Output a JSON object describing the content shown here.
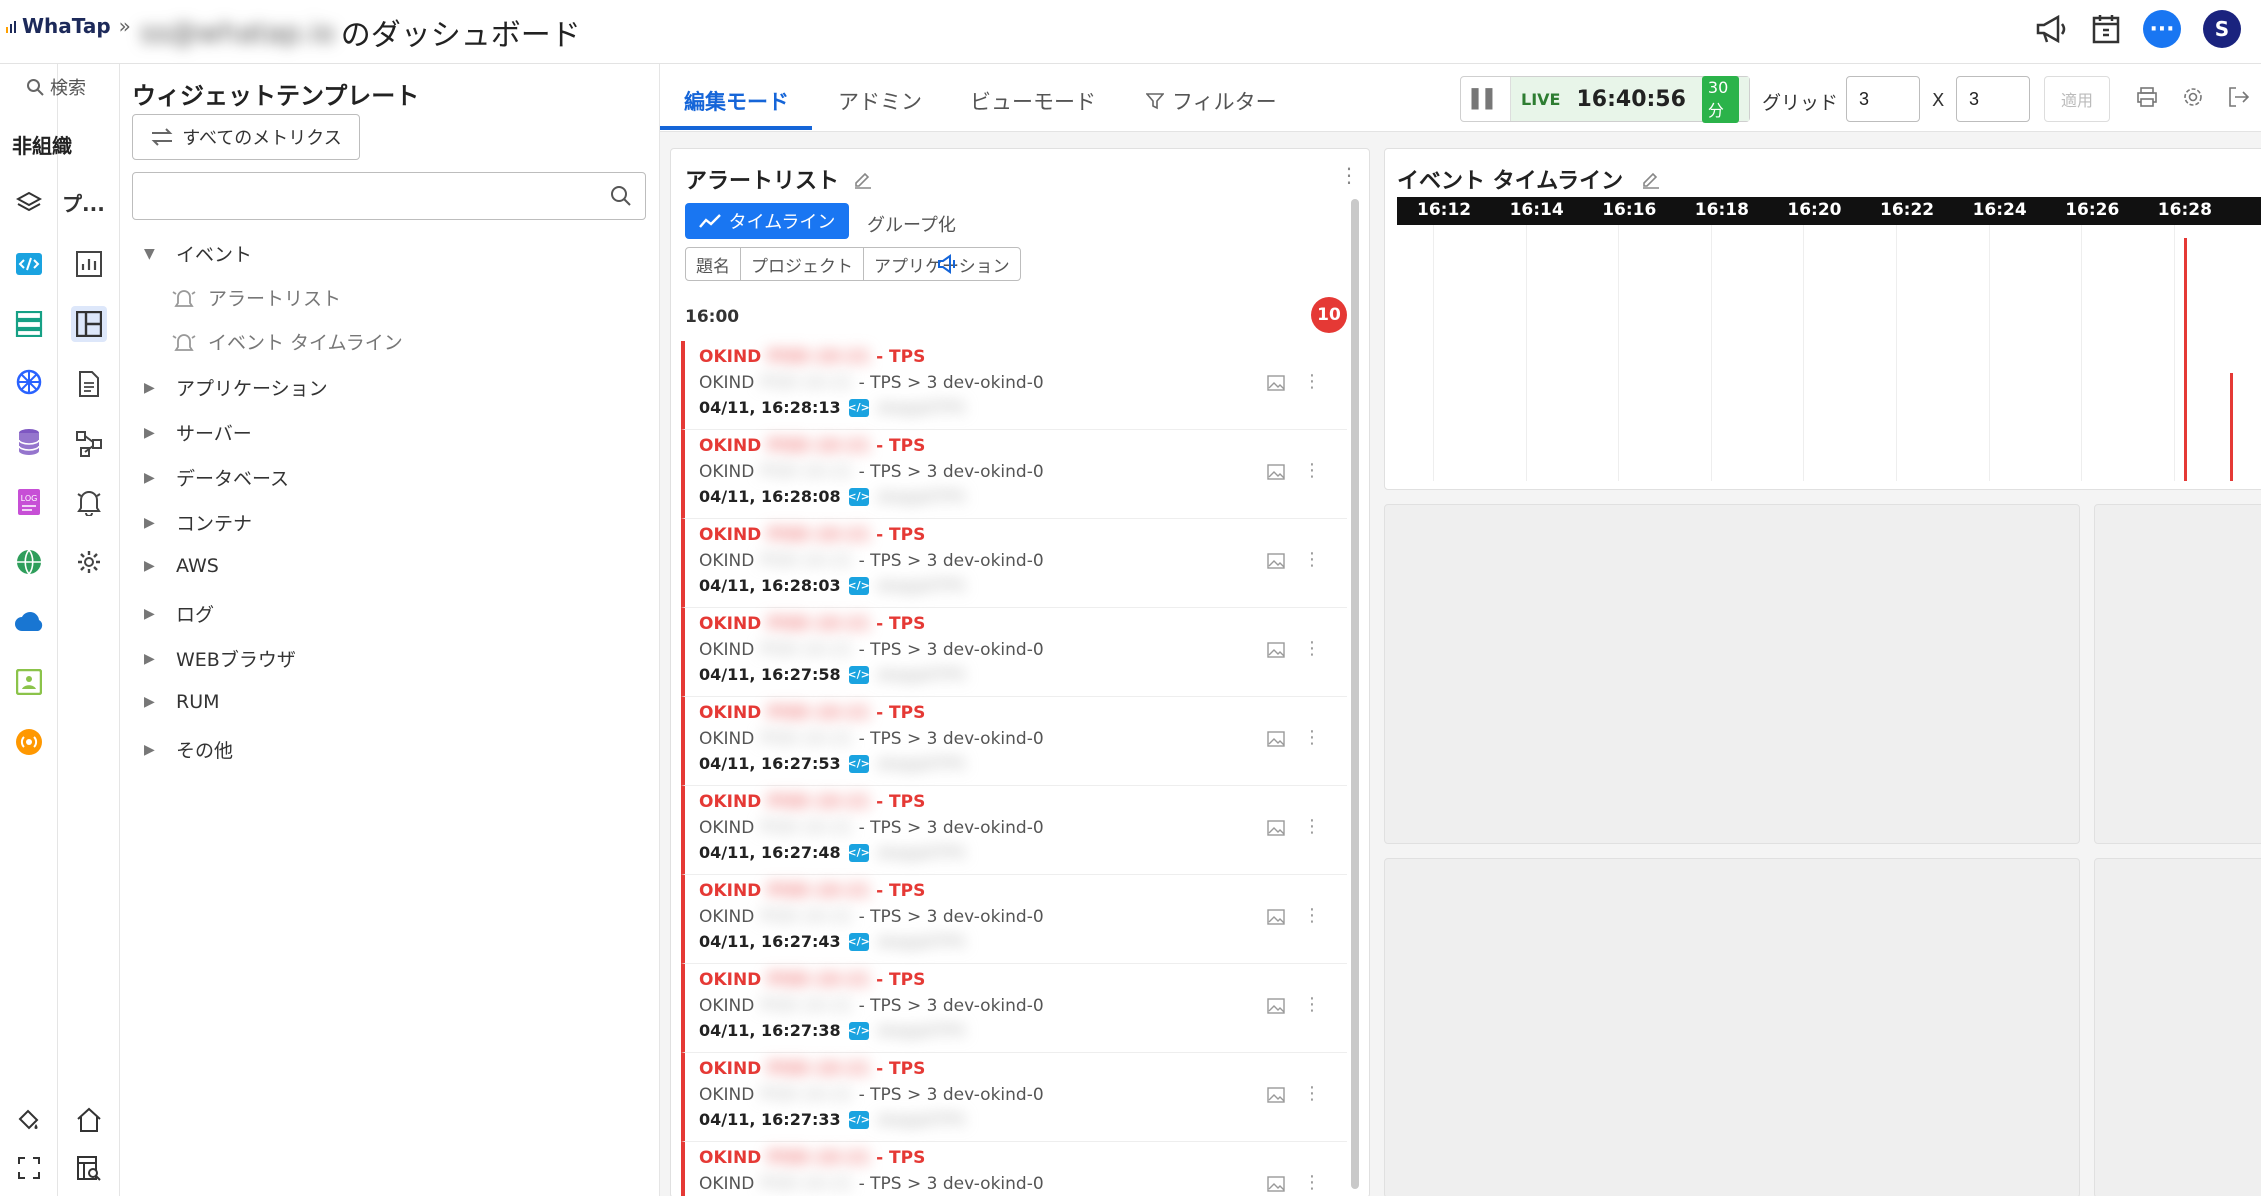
{
  "brand": {
    "name": "WhaTap"
  },
  "header": {
    "owner_blurred": "ss@whatap.io",
    "title_suffix": "のダッシュボード",
    "avatar_letter": "S",
    "chat_glyph": "···"
  },
  "nav": {
    "search": "検索",
    "org": "非組織",
    "project": "プ..."
  },
  "template": {
    "title": "ウィジェットテンプレート",
    "all_metrics": "すべてのメトリクス",
    "search_placeholder": "",
    "tree": {
      "event": "イベント",
      "event_children": [
        "アラートリスト",
        "イベント タイムライン"
      ],
      "items": [
        "アプリケーション",
        "サーバー",
        "データベース",
        "コンテナ",
        "AWS",
        "ログ",
        "WEBブラウザ",
        "RUM",
        "その他"
      ]
    }
  },
  "tabs": [
    "編集モード",
    "アドミン",
    "ビューモード",
    "フィルター"
  ],
  "live": {
    "label": "LIVE",
    "time": "16:40:56",
    "range": "30分"
  },
  "grid": {
    "label": "グリッド",
    "rows": "3",
    "x": "X",
    "cols": "3",
    "apply": "適用"
  },
  "alert_widget": {
    "title": "アラートリスト",
    "timeline_btn": "タイムライン",
    "group_btn": "グループ化",
    "filters": [
      "題名",
      "プロジェクト",
      "アプリケーション"
    ],
    "hour": "16:00",
    "count": "10",
    "items": [
      {
        "title": "- TPS",
        "prefix": "OKIND",
        "blur": "POD-10-21",
        "desc": "- TPS > 3 dev-okind-0",
        "time": "04/11, 16:28:13",
        "app_blur": "okapp0TPS"
      },
      {
        "title": "- TPS",
        "prefix": "OKIND",
        "blur": "POD-10-21",
        "desc": "- TPS > 3 dev-okind-0",
        "time": "04/11, 16:28:08",
        "app_blur": "okapp0TPS"
      },
      {
        "title": "- TPS",
        "prefix": "OKIND",
        "blur": "POD-10-21",
        "desc": "- TPS > 3 dev-okind-0",
        "time": "04/11, 16:28:03",
        "app_blur": "okapp0TPS"
      },
      {
        "title": "- TPS",
        "prefix": "OKIND",
        "blur": "POD-10-21",
        "desc": "- TPS > 3 dev-okind-0",
        "time": "04/11, 16:27:58",
        "app_blur": "okapp0TPS"
      },
      {
        "title": "- TPS",
        "prefix": "OKIND",
        "blur": "POD-10-21",
        "desc": "- TPS > 3 dev-okind-0",
        "time": "04/11, 16:27:53",
        "app_blur": "okapp0TPS"
      },
      {
        "title": "- TPS",
        "prefix": "OKIND",
        "blur": "POD-10-21",
        "desc": "- TPS > 3 dev-okind-0",
        "time": "04/11, 16:27:48",
        "app_blur": "okapp0TPS"
      },
      {
        "title": "- TPS",
        "prefix": "OKIND",
        "blur": "POD-10-21",
        "desc": "- TPS > 3 dev-okind-0",
        "time": "04/11, 16:27:43",
        "app_blur": "okapp0TPS"
      },
      {
        "title": "- TPS",
        "prefix": "OKIND",
        "blur": "POD-10-21",
        "desc": "- TPS > 3 dev-okind-0",
        "time": "04/11, 16:27:38",
        "app_blur": "okapp0TPS"
      },
      {
        "title": "- TPS",
        "prefix": "OKIND",
        "blur": "POD-10-21",
        "desc": "- TPS > 3 dev-okind-0",
        "time": "04/11, 16:27:33",
        "app_blur": "okapp0TPS"
      },
      {
        "title": "- TPS",
        "prefix": "OKIND",
        "blur": "POD-10-21",
        "desc": "- TPS > 3 dev-okind-0",
        "time": "",
        "app_blur": ""
      }
    ]
  },
  "timeline_widget": {
    "title": "イベント タイムライン",
    "ticks": [
      "16:12",
      "16:14",
      "16:16",
      "16:18",
      "16:20",
      "16:22",
      "16:24",
      "16:26",
      "16:28"
    ],
    "events": [
      {
        "time": "16:28:13",
        "level": 0.95
      },
      {
        "time": "16:29:13",
        "level": 0.42
      }
    ]
  },
  "colors": {
    "accent": "#1565d8",
    "critical": "#e53935",
    "live": "#2bb34a"
  }
}
